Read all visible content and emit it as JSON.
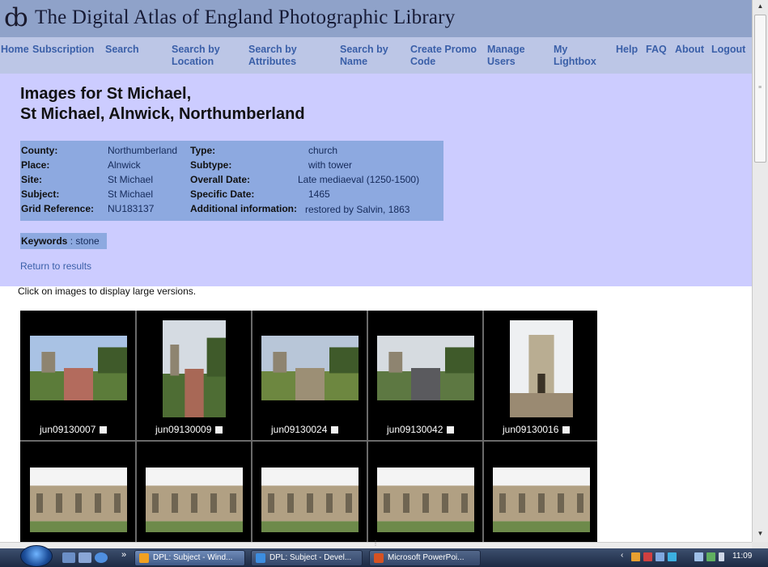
{
  "header": {
    "logo_glyph": "ȸ",
    "title": "The Digital Atlas of England Photographic Library"
  },
  "nav": [
    {
      "label": "Home"
    },
    {
      "label": "Subscription"
    },
    {
      "label": "Search"
    },
    {
      "label": "Search by\nLocation"
    },
    {
      "label": "Search by\nAttributes"
    },
    {
      "label": "Search by\nName"
    },
    {
      "label": "Create Promo\nCode"
    },
    {
      "label": "Manage\nUsers"
    },
    {
      "label": "My\nLightbox"
    },
    {
      "label": "Help"
    },
    {
      "label": "FAQ"
    },
    {
      "label": "About"
    },
    {
      "label": "Logout"
    }
  ],
  "page": {
    "title_line1": "Images for St Michael,",
    "title_line2": "St Michael, Alnwick, Northumberland"
  },
  "info": {
    "left": [
      {
        "label": "County:",
        "value": "Northumberland"
      },
      {
        "label": "Place:",
        "value": "Alnwick"
      },
      {
        "label": "Site:",
        "value": "St Michael"
      },
      {
        "label": "Subject:",
        "value": "St Michael"
      },
      {
        "label": "Grid Reference:",
        "value": "NU183137"
      }
    ],
    "right": [
      {
        "label": "Type:",
        "value": "church"
      },
      {
        "label": "Subtype:",
        "value": "with tower"
      },
      {
        "label": "Overall Date:",
        "value": "Late mediaeval (1250-1500)"
      },
      {
        "label": "Specific Date:",
        "value": "1465"
      },
      {
        "label": "Additional information:",
        "value": "restored by Salvin, 1863"
      }
    ]
  },
  "keywords": {
    "label": "Keywords",
    "sep": " : ",
    "value": "stone"
  },
  "return_link": "Return to results",
  "click_hint": "Click on images to display large versions.",
  "thumbnails": [
    {
      "id": "jun09130007",
      "shape": "landscape",
      "scene": "path"
    },
    {
      "id": "jun09130009",
      "shape": "portrait",
      "scene": "path-tower"
    },
    {
      "id": "jun09130024",
      "shape": "landscape",
      "scene": "graveyard"
    },
    {
      "id": "jun09130042",
      "shape": "landscape",
      "scene": "road"
    },
    {
      "id": "jun09130016",
      "shape": "portrait",
      "scene": "tower"
    },
    {
      "id": "",
      "shape": "landscape",
      "scene": "wall"
    },
    {
      "id": "",
      "shape": "landscape",
      "scene": "wall"
    },
    {
      "id": "",
      "shape": "landscape",
      "scene": "wall"
    },
    {
      "id": "",
      "shape": "landscape",
      "scene": "wall"
    },
    {
      "id": "",
      "shape": "landscape",
      "scene": "wall"
    }
  ],
  "taskbar": {
    "chevron": "»",
    "buttons": [
      {
        "label": "DPL: Subject - Wind...",
        "icon_color": "#f0a020",
        "active": true
      },
      {
        "label": "DPL: Subject - Devel...",
        "icon_color": "#3c8de0",
        "active": false
      },
      {
        "label": "Microsoft PowerPoi...",
        "icon_color": "#d65222",
        "active": false
      }
    ],
    "time": "11:09"
  },
  "colors": {
    "page_bg": "#ccccff",
    "header_bg": "#8fa2c9",
    "nav_bg": "#bcc6e6",
    "link": "#3a5fa8",
    "info_bg": "#8da9e0"
  }
}
